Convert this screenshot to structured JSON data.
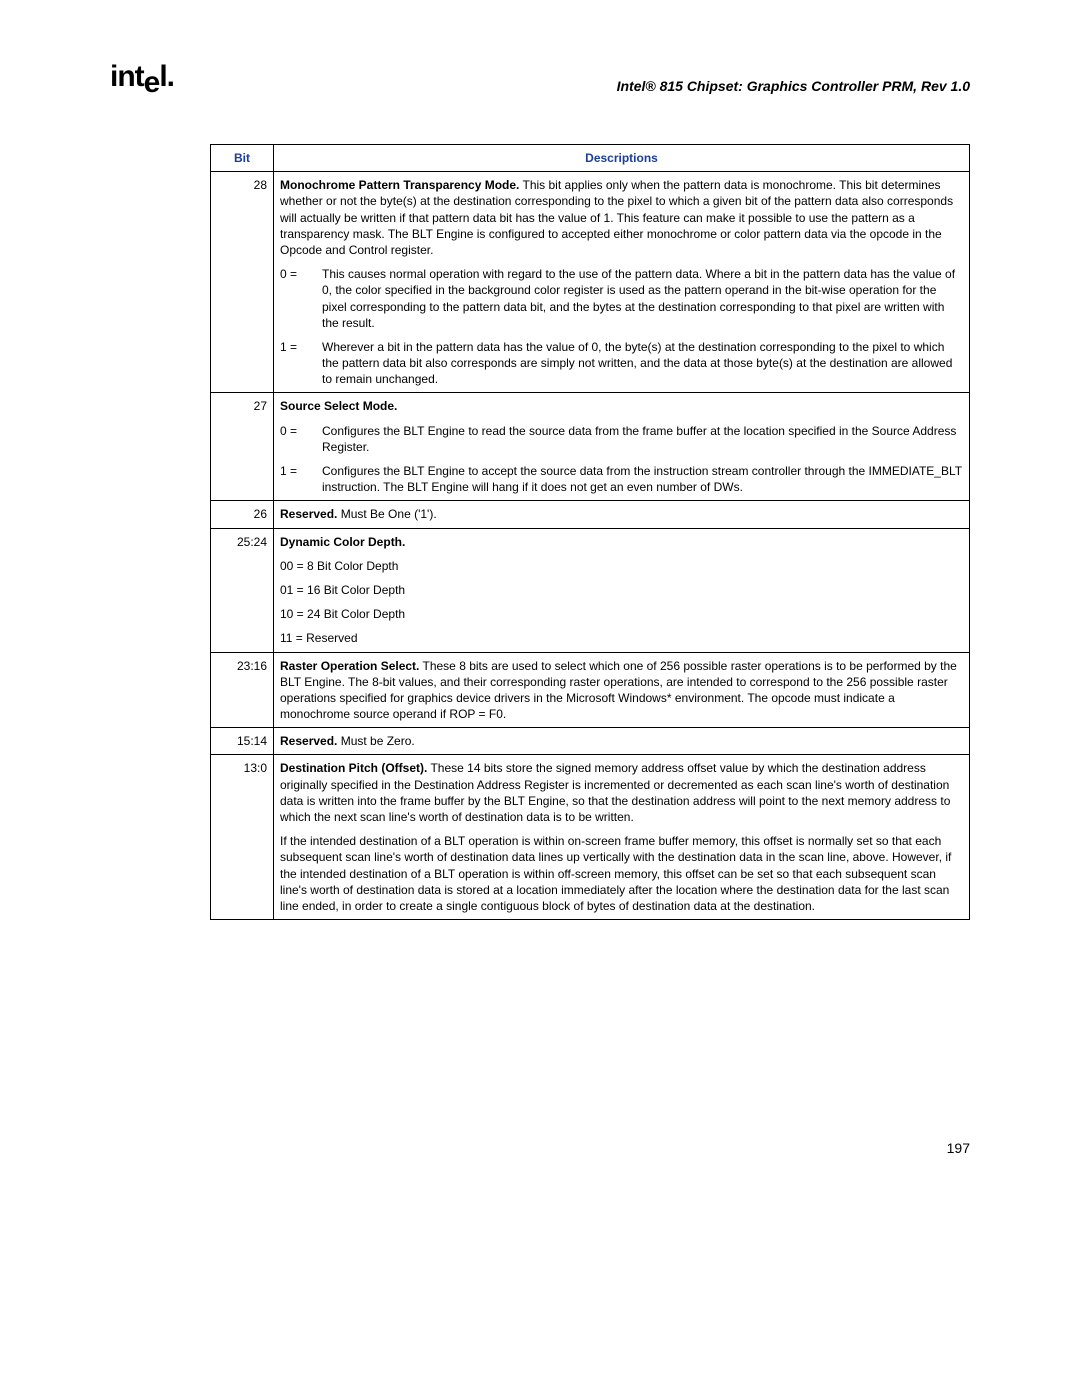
{
  "header": {
    "doc_title": "Intel® 815 Chipset: Graphics Controller PRM, Rev 1.0",
    "page_number": "197"
  },
  "table": {
    "col_bit": "Bit",
    "col_desc": "Descriptions",
    "rows": [
      {
        "bit": "28",
        "para1_bold": "Monochrome Pattern Transparency Mode.",
        "para1_rest": " This bit applies only when the pattern data is monochrome. This bit determines whether or not the byte(s) at the destination corresponding to the pixel to which a given bit of the pattern data also corresponds will actually be written if that pattern data bit has the value of 1. This feature can make it possible to use the pattern as a transparency mask. The BLT Engine is configured to accepted either monochrome or color pattern data via the opcode in the Opcode and Control register.",
        "sub": [
          {
            "k": "0 =",
            "v": "This causes normal operation with regard to the use of the pattern data. Where a bit in the pattern data has the value of 0, the color specified in the background color register is used as the pattern operand in the bit-wise operation for the pixel corresponding to the pattern data bit, and the bytes at the destination corresponding to that pixel are written with the result."
          },
          {
            "k": "1 =",
            "v": "Wherever a bit in the pattern data has the value of 0, the byte(s) at the destination corresponding to the pixel to which the pattern data bit also corresponds are simply not written, and the data at those byte(s) at the destination are allowed to remain unchanged."
          }
        ]
      },
      {
        "bit": "27",
        "para1_bold": "Source Select Mode.",
        "para1_rest": "",
        "sub": [
          {
            "k": "0 =",
            "v": "Configures the BLT Engine to read the source data from the frame buffer at the location specified in the Source Address Register."
          },
          {
            "k": "1 =",
            "v": "Configures the BLT Engine to accept the source data from the instruction stream controller through the IMMEDIATE_BLT instruction. The BLT Engine will hang if it does not get an even number of DWs."
          }
        ]
      },
      {
        "bit": "26",
        "para1_bold": "Reserved.",
        "para1_rest": " Must Be One ('1')."
      },
      {
        "bit": "25:24",
        "para1_bold": "Dynamic Color Depth.",
        "para1_rest": "",
        "lines": [
          "00 = 8 Bit Color Depth",
          "01 = 16 Bit Color Depth",
          "10 = 24 Bit Color Depth",
          "11 = Reserved"
        ]
      },
      {
        "bit": "23:16",
        "para1_bold": "Raster Operation Select.",
        "para1_rest": " These 8 bits are used to select which one of 256 possible raster operations is to be performed by the BLT Engine. The 8-bit values, and their corresponding raster operations, are intended to correspond to the 256 possible raster operations specified for graphics device drivers in the Microsoft Windows* environment. The opcode must indicate a monochrome source operand if ROP = F0."
      },
      {
        "bit": "15:14",
        "para1_bold": "Reserved.",
        "para1_rest": " Must be Zero."
      },
      {
        "bit": "13:0",
        "para1_bold": "Destination Pitch (Offset).",
        "para1_rest": " These 14 bits store the signed memory address offset value by which the destination address originally specified in the Destination Address Register is incremented or decremented as each scan line's worth of destination data is written into the frame buffer by the BLT Engine, so that the destination address will point to the next memory address to which the next scan line's worth of destination data is to be written.",
        "para2": "If the intended destination of a BLT operation is within on-screen frame buffer memory, this offset is normally set so that each subsequent scan line's worth of destination data lines up vertically with the destination data in the scan line, above. However, if the intended destination of a BLT operation is within off-screen memory, this offset can be set so that each subsequent scan line's worth of destination data is stored at a location immediately after the location where the destination data for the last scan line ended, in order to create a single contiguous block of bytes of destination data at the destination."
      }
    ]
  }
}
